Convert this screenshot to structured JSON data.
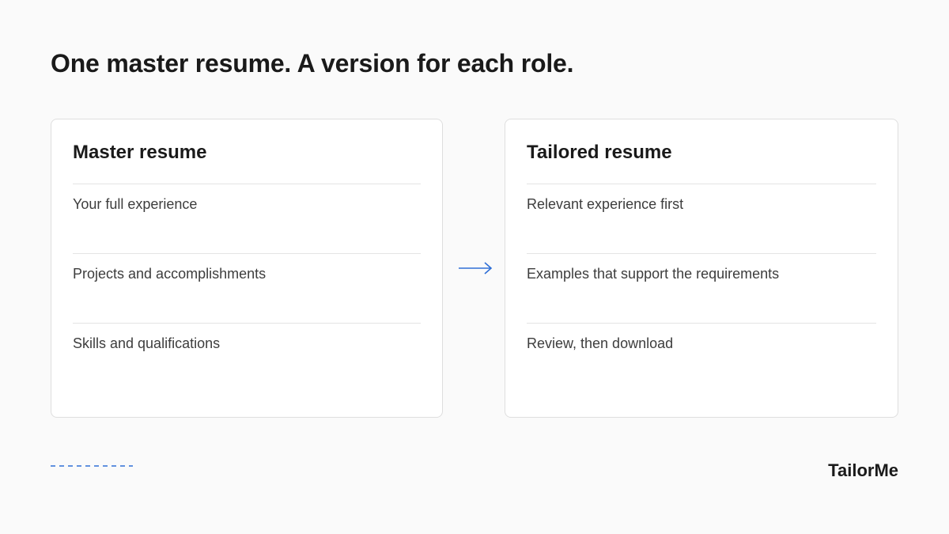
{
  "headline": "One master resume. A version for each role.",
  "master": {
    "title": "Master resume",
    "items": [
      "Your full experience",
      "Projects and accomplishments",
      "Skills and qualifications"
    ]
  },
  "tailored": {
    "title": "Tailored resume",
    "items": [
      "Relevant experience first",
      "Examples that support the requirements",
      "Review, then download"
    ]
  },
  "brand": "TailorMe",
  "colors": {
    "accent": "#2f6fd6",
    "background": "#fafafa",
    "text": "#1a1a1a"
  },
  "icons": {
    "transition": "arrow-right-icon"
  }
}
